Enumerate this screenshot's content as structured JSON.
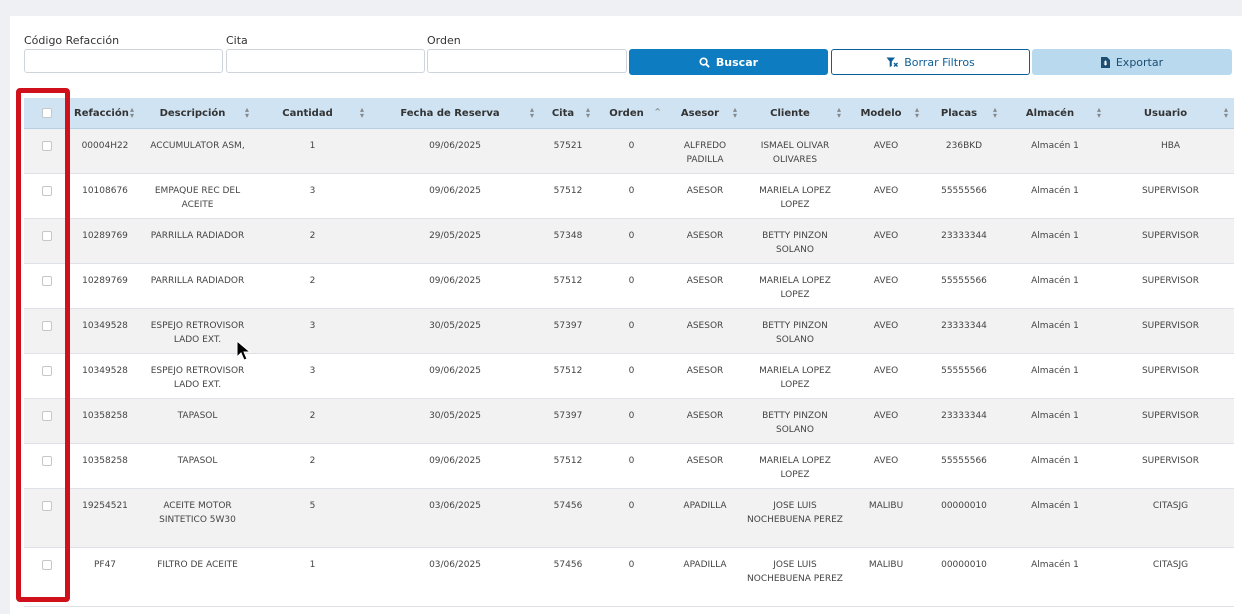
{
  "filters": {
    "codigo_label": "Código Refacción",
    "codigo_value": "",
    "cita_label": "Cita",
    "cita_value": "",
    "orden_label": "Orden",
    "orden_value": ""
  },
  "buttons": {
    "buscar": "Buscar",
    "borrar": "Borrar Filtros",
    "exportar": "Exportar"
  },
  "colors": {
    "primary": "#0d7cc1",
    "header_bg": "#cfe3f3",
    "highlight_border": "#d0101a"
  },
  "table": {
    "columns": [
      "Refacción",
      "Descripción",
      "Cantidad",
      "Fecha de Reserva",
      "Cita",
      "Orden",
      "Asesor",
      "Cliente",
      "Modelo",
      "Placas",
      "Almacén",
      "Usuario"
    ],
    "rows": [
      {
        "refaccion": "00004H22",
        "descripcion": "ACCUMULATOR ASM,",
        "cantidad": "1",
        "fecha": "09/06/2025",
        "cita": "57521",
        "orden": "0",
        "asesor": "ALFREDO PADILLA",
        "cliente": "ISMAEL OLIVAR OLIVARES",
        "modelo": "AVEO",
        "placas": "236BKD",
        "almacen": "Almacén 1",
        "usuario": "HBA"
      },
      {
        "refaccion": "10108676",
        "descripcion": "EMPAQUE REC DEL ACEITE",
        "cantidad": "3",
        "fecha": "09/06/2025",
        "cita": "57512",
        "orden": "0",
        "asesor": "ASESOR",
        "cliente": "MARIELA LOPEZ LOPEZ",
        "modelo": "AVEO",
        "placas": "55555566",
        "almacen": "Almacén 1",
        "usuario": "SUPERVISOR"
      },
      {
        "refaccion": "10289769",
        "descripcion": "PARRILLA RADIADOR",
        "cantidad": "2",
        "fecha": "29/05/2025",
        "cita": "57348",
        "orden": "0",
        "asesor": "ASESOR",
        "cliente": "BETTY PINZON SOLANO",
        "modelo": "AVEO",
        "placas": "23333344",
        "almacen": "Almacén 1",
        "usuario": "SUPERVISOR"
      },
      {
        "refaccion": "10289769",
        "descripcion": "PARRILLA RADIADOR",
        "cantidad": "2",
        "fecha": "09/06/2025",
        "cita": "57512",
        "orden": "0",
        "asesor": "ASESOR",
        "cliente": "MARIELA LOPEZ LOPEZ",
        "modelo": "AVEO",
        "placas": "55555566",
        "almacen": "Almacén 1",
        "usuario": "SUPERVISOR"
      },
      {
        "refaccion": "10349528",
        "descripcion": "ESPEJO RETROVISOR LADO EXT.",
        "cantidad": "3",
        "fecha": "30/05/2025",
        "cita": "57397",
        "orden": "0",
        "asesor": "ASESOR",
        "cliente": "BETTY PINZON SOLANO",
        "modelo": "AVEO",
        "placas": "23333344",
        "almacen": "Almacén 1",
        "usuario": "SUPERVISOR"
      },
      {
        "refaccion": "10349528",
        "descripcion": "ESPEJO RETROVISOR LADO EXT.",
        "cantidad": "3",
        "fecha": "09/06/2025",
        "cita": "57512",
        "orden": "0",
        "asesor": "ASESOR",
        "cliente": "MARIELA LOPEZ LOPEZ",
        "modelo": "AVEO",
        "placas": "55555566",
        "almacen": "Almacén 1",
        "usuario": "SUPERVISOR"
      },
      {
        "refaccion": "10358258",
        "descripcion": "TAPASOL",
        "cantidad": "2",
        "fecha": "30/05/2025",
        "cita": "57397",
        "orden": "0",
        "asesor": "ASESOR",
        "cliente": "BETTY PINZON SOLANO",
        "modelo": "AVEO",
        "placas": "23333344",
        "almacen": "Almacén 1",
        "usuario": "SUPERVISOR"
      },
      {
        "refaccion": "10358258",
        "descripcion": "TAPASOL",
        "cantidad": "2",
        "fecha": "09/06/2025",
        "cita": "57512",
        "orden": "0",
        "asesor": "ASESOR",
        "cliente": "MARIELA LOPEZ LOPEZ",
        "modelo": "AVEO",
        "placas": "55555566",
        "almacen": "Almacén 1",
        "usuario": "SUPERVISOR"
      },
      {
        "refaccion": "19254521",
        "descripcion": "ACEITE MOTOR SINTETICO 5W30",
        "cantidad": "5",
        "fecha": "03/06/2025",
        "cita": "57456",
        "orden": "0",
        "asesor": "APADILLA",
        "cliente": "JOSE LUIS NOCHEBUENA PEREZ",
        "modelo": "MALIBU",
        "placas": "00000010",
        "almacen": "Almacén 1",
        "usuario": "CITASJG"
      },
      {
        "refaccion": "PF47",
        "descripcion": "FILTRO DE ACEITE",
        "cantidad": "1",
        "fecha": "03/06/2025",
        "cita": "57456",
        "orden": "0",
        "asesor": "APADILLA",
        "cliente": "JOSE LUIS NOCHEBUENA PEREZ",
        "modelo": "MALIBU",
        "placas": "00000010",
        "almacen": "Almacén 1",
        "usuario": "CITASJG"
      }
    ]
  }
}
